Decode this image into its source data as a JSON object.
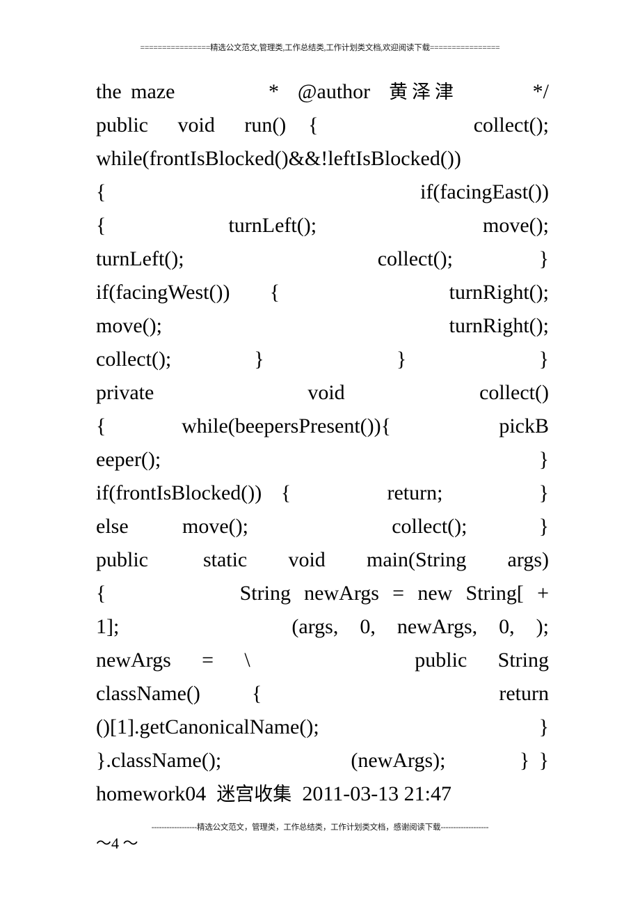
{
  "document": {
    "page_marker": "～4 ～",
    "header_banner": "================精选公文范文,管理类,工作总结类,工作计划类文档,欢迎阅读下载================",
    "footer_banner": "------------------精选公文范文，管理类，工作总结类，工作计划类文档，感谢阅读下载-------------------"
  },
  "body": {
    "lines": [
      {
        "id": "line-01",
        "text": "the maze          *  @author  黄泽津        */",
        "justify": true
      },
      {
        "id": "line-02",
        "text": "public    void    run()   {                     collect();",
        "justify": true
      },
      {
        "id": "line-03",
        "text": "while(frontIsBlocked()&&!leftIsBlocked())",
        "justify": true
      },
      {
        "id": "line-04",
        "text": "{                                   if(facingEast())",
        "justify": true
      },
      {
        "id": "line-05",
        "text": "{              turnLeft();                   move();",
        "justify": true
      },
      {
        "id": "line-06",
        "text": "turnLeft();                  collect();        }",
        "justify": true
      },
      {
        "id": "line-07",
        "text": "if(facingWest())    {                 turnRight();",
        "justify": true
      },
      {
        "id": "line-08",
        "text": "move();                             turnRight();",
        "justify": true
      },
      {
        "id": "line-09",
        "text": "collect();          }                }                }",
        "justify": true
      },
      {
        "id": "line-10",
        "text": "private                void              collect()",
        "justify": true
      },
      {
        "id": "line-11",
        "text": "{       while(beepersPresent()){          pickB",
        "justify": true
      },
      {
        "id": "line-12",
        "text": "eeper();                                        }",
        "justify": true
      },
      {
        "id": "line-13",
        "text": "if(frontIsBlocked())  {          return;          }",
        "justify": true
      },
      {
        "id": "line-14",
        "text": "else      move();                collect();        }",
        "justify": true
      },
      {
        "id": "line-15",
        "text": "public    static   void   main(String   args)",
        "justify": true
      },
      {
        "id": "line-16",
        "text": "{          String newArgs = new String[ +",
        "justify": true
      },
      {
        "id": "line-17",
        "text": "1];                (args,  0,  newArgs,  0,  );",
        "justify": true
      },
      {
        "id": "line-18",
        "text": "newArgs   =   \\                public   String",
        "justify": true
      },
      {
        "id": "line-19",
        "text": "className()     {                       return",
        "justify": true
      },
      {
        "id": "line-20",
        "text": "()[1].getCanonicalName();                        }",
        "justify": true
      },
      {
        "id": "line-21",
        "text": "}.className();              (newArgs);        } }",
        "justify": true
      },
      {
        "id": "line-22",
        "text": "homework04  迷宫收集  2011-03-13 21:47",
        "justify": false
      }
    ]
  }
}
